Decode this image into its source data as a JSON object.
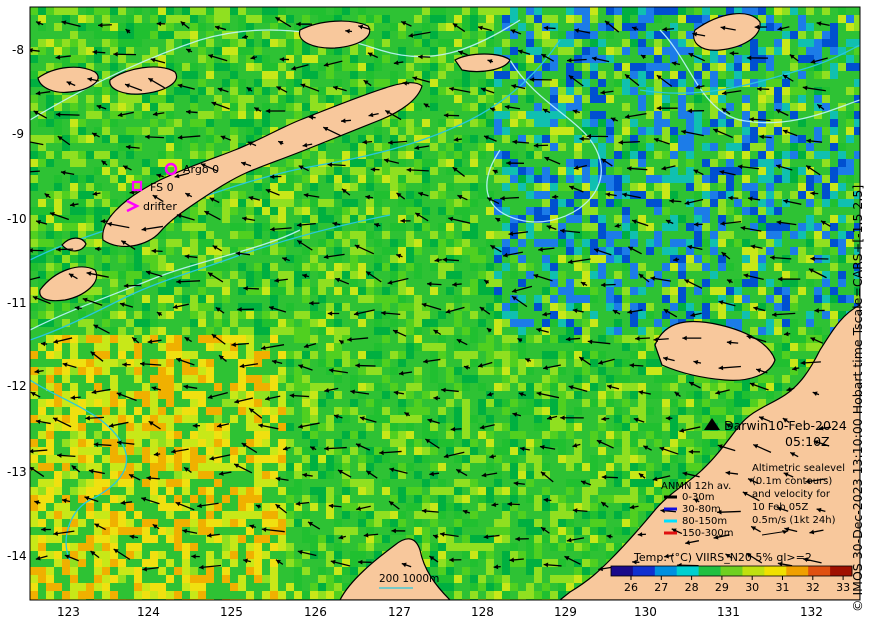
{
  "map": {
    "lon_ticks": [
      "123",
      "124",
      "125",
      "126",
      "127",
      "128",
      "129",
      "130",
      "131",
      "132"
    ],
    "lat_ticks": [
      "-8",
      "-9",
      "-10",
      "-11",
      "-12",
      "-13",
      "-14"
    ],
    "date": "10-Feb-2024",
    "time": "05:10Z",
    "place_label": "Darwin",
    "legend_markers": {
      "argo": "Argo 0",
      "fs": "FS 0",
      "drifter": "drifter"
    },
    "anmn": {
      "title": "ANMN 12h av.",
      "items": [
        {
          "label": "0-30m",
          "color": "#000000"
        },
        {
          "label": "30-80m",
          "color": "#1010e0"
        },
        {
          "label": "80-150m",
          "color": "#00e0ff"
        },
        {
          "label": "150-300m",
          "color": "#e01010"
        }
      ]
    },
    "altimetry_note": [
      "Altimetric sealevel",
      "(0.1m contours)",
      "and velocity for",
      "10 Feb 05Z",
      "0.5m/s (1kt 24h)"
    ],
    "isobath_label": "200  1000m",
    "colorbar": {
      "title": "Temp. (°C) VIIRS_N20 5% ql>=2",
      "ticks": [
        "26",
        "27",
        "28",
        "29",
        "30",
        "31",
        "32",
        "33"
      ],
      "colors": [
        "#1a0a8a",
        "#1030d0",
        "#0090e0",
        "#00d0d0",
        "#20c040",
        "#70d020",
        "#c0e010",
        "#f0e000",
        "#f0a000",
        "#e05010",
        "#a01000"
      ]
    },
    "credit": "© IMOS 30-Dec-2023 13:10:00 Hobart time Tscale=CARS+[-1.5 2.5]"
  }
}
